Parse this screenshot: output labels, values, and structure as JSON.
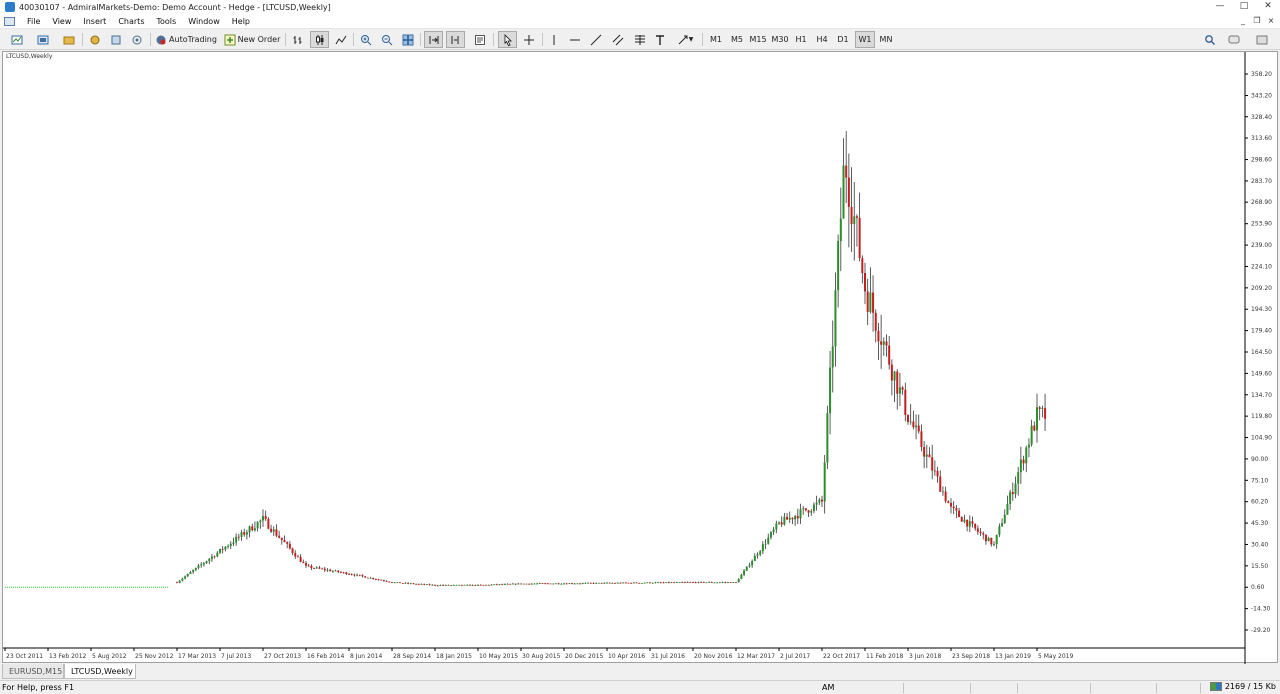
{
  "window": {
    "title": "40030107 - AdmiralMarkets-Demo: Demo Account - Hedge - [LTCUSD,Weekly]"
  },
  "menu": [
    "File",
    "View",
    "Insert",
    "Charts",
    "Tools",
    "Window",
    "Help"
  ],
  "toolbar": {
    "autotrading": "AutoTrading",
    "new_order": "New Order",
    "periods": [
      "M1",
      "M5",
      "M15",
      "M30",
      "H1",
      "H4",
      "D1",
      "W1",
      "MN"
    ],
    "active_period": "W1"
  },
  "chart": {
    "label": "LTCUSD,Weekly",
    "colors": {
      "up": "#2e8b2e",
      "down": "#c21f1f",
      "wick": "#333333",
      "line": "#32cd32",
      "grid": "#ffffff"
    }
  },
  "chart_data": {
    "type": "candlestick",
    "symbol": "LTCUSD",
    "timeframe": "Weekly",
    "y_ticks": [
      "358.20",
      "343.20",
      "328.40",
      "313.60",
      "298.60",
      "283.70",
      "268.90",
      "253.90",
      "239.00",
      "224.10",
      "209.20",
      "194.30",
      "179.40",
      "164.50",
      "149.60",
      "134.70",
      "119.80",
      "104.90",
      "90.00",
      "75.10",
      "60.20",
      "45.30",
      "30.40",
      "15.50",
      "0.60",
      "-14.30",
      "-29.20"
    ],
    "x_ticks": [
      "23 Oct 2011",
      "13 Feb 2012",
      "5 Aug 2012",
      "25 Nov 2012",
      "17 Mar 2013",
      "7 Jul 2013",
      "27 Oct 2013",
      "16 Feb 2014",
      "8 Jun 2014",
      "28 Sep 2014",
      "18 Jan 2015",
      "10 May 2015",
      "30 Aug 2015",
      "20 Dec 2015",
      "10 Apr 2016",
      "31 Jul 2016",
      "20 Nov 2016",
      "12 Mar 2017",
      "2 Jul 2017",
      "22 Oct 2017",
      "11 Feb 2018",
      "3 Jun 2018",
      "23 Sep 2018",
      "13 Jan 2019",
      "5 May 2019"
    ],
    "ylim": [
      -29.2,
      358.2
    ],
    "key_points": [
      {
        "date": "23 Oct 2011",
        "close": 0.6
      },
      {
        "date": "17 Mar 2013",
        "close": 4
      },
      {
        "date": "27 Oct 2013",
        "close": 48
      },
      {
        "date": "16 Feb 2014",
        "close": 15
      },
      {
        "date": "8 Jun 2014",
        "close": 10
      },
      {
        "date": "28 Sep 2014",
        "close": 4
      },
      {
        "date": "18 Jan 2015",
        "close": 2
      },
      {
        "date": "10 May 2015",
        "close": 2
      },
      {
        "date": "30 Aug 2015",
        "close": 3
      },
      {
        "date": "20 Nov 2016",
        "close": 4
      },
      {
        "date": "12 Mar 2017",
        "close": 4
      },
      {
        "date": "2 Jul 2017",
        "close": 45
      },
      {
        "date": "22 Oct 2017",
        "close": 60
      },
      {
        "date": "20 Dec 2017",
        "close": 300
      },
      {
        "date": "11 Feb 2018",
        "close": 210
      },
      {
        "date": "3 Jun 2018",
        "close": 120
      },
      {
        "date": "23 Sep 2018",
        "close": 55
      },
      {
        "date": "13 Jan 2019",
        "close": 30
      },
      {
        "date": "5 May 2019",
        "close": 120
      }
    ]
  },
  "tabs": [
    "EURUSD,M15",
    "LTCUSD,Weekly"
  ],
  "active_tab": "LTCUSD,Weekly",
  "status": {
    "help": "For Help, press F1",
    "profile": "AM",
    "traffic": "2169 / 15 Kb"
  }
}
